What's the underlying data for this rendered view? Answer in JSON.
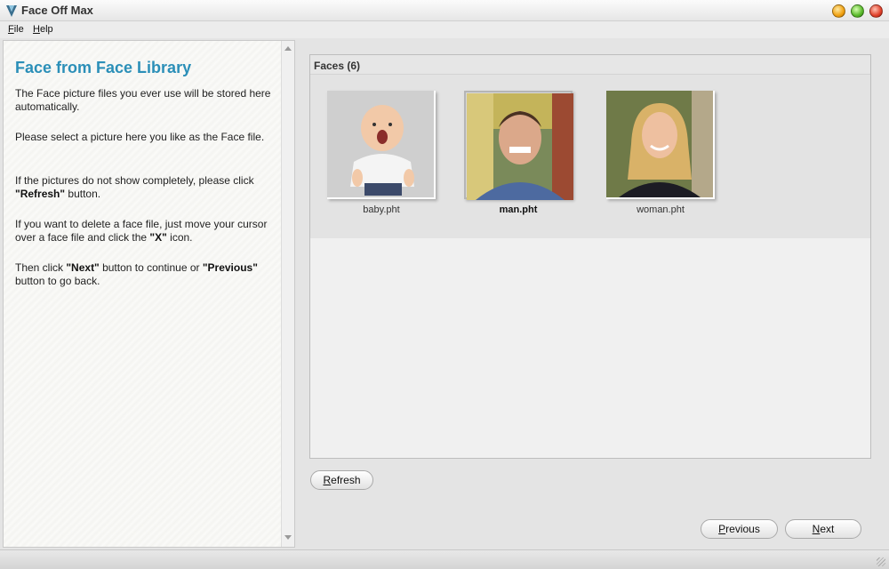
{
  "window": {
    "title": "Face Off Max"
  },
  "menu": {
    "items": [
      "File",
      "Help"
    ]
  },
  "left_panel": {
    "heading": "Face from Face Library",
    "paragraphs": [
      {
        "segments": [
          {
            "text": "The Face picture files you ever use will be stored here automatically."
          }
        ]
      },
      {
        "segments": [
          {
            "text": "Please select a picture here you like as the Face file."
          }
        ]
      },
      {
        "segments": [
          {
            "text": "If the pictures do not show completely, please click "
          },
          {
            "text": "\"Refresh\"",
            "bold": true
          },
          {
            "text": " button."
          }
        ]
      },
      {
        "segments": [
          {
            "text": "If you want to delete a face file, just move your cursor over a face file and click the "
          },
          {
            "text": "\"X\"",
            "bold": true
          },
          {
            "text": " icon."
          }
        ]
      },
      {
        "segments": [
          {
            "text": "Then click "
          },
          {
            "text": "\"Next\"",
            "bold": true
          },
          {
            "text": " button to continue or "
          },
          {
            "text": "\"Previous\"",
            "bold": true
          },
          {
            "text": " button to go back."
          }
        ]
      }
    ]
  },
  "faces": {
    "title": "Faces (6)",
    "items": [
      {
        "label": "baby.pht",
        "selected": false
      },
      {
        "label": "man.pht",
        "selected": true
      },
      {
        "label": "woman.pht",
        "selected": false
      }
    ]
  },
  "buttons": {
    "refresh": "Refresh",
    "previous": "Previous",
    "next": "Next"
  },
  "colors": {
    "heading": "#2b8fb8",
    "min": "#f0a010",
    "max": "#58b82a",
    "close": "#e0402a"
  }
}
